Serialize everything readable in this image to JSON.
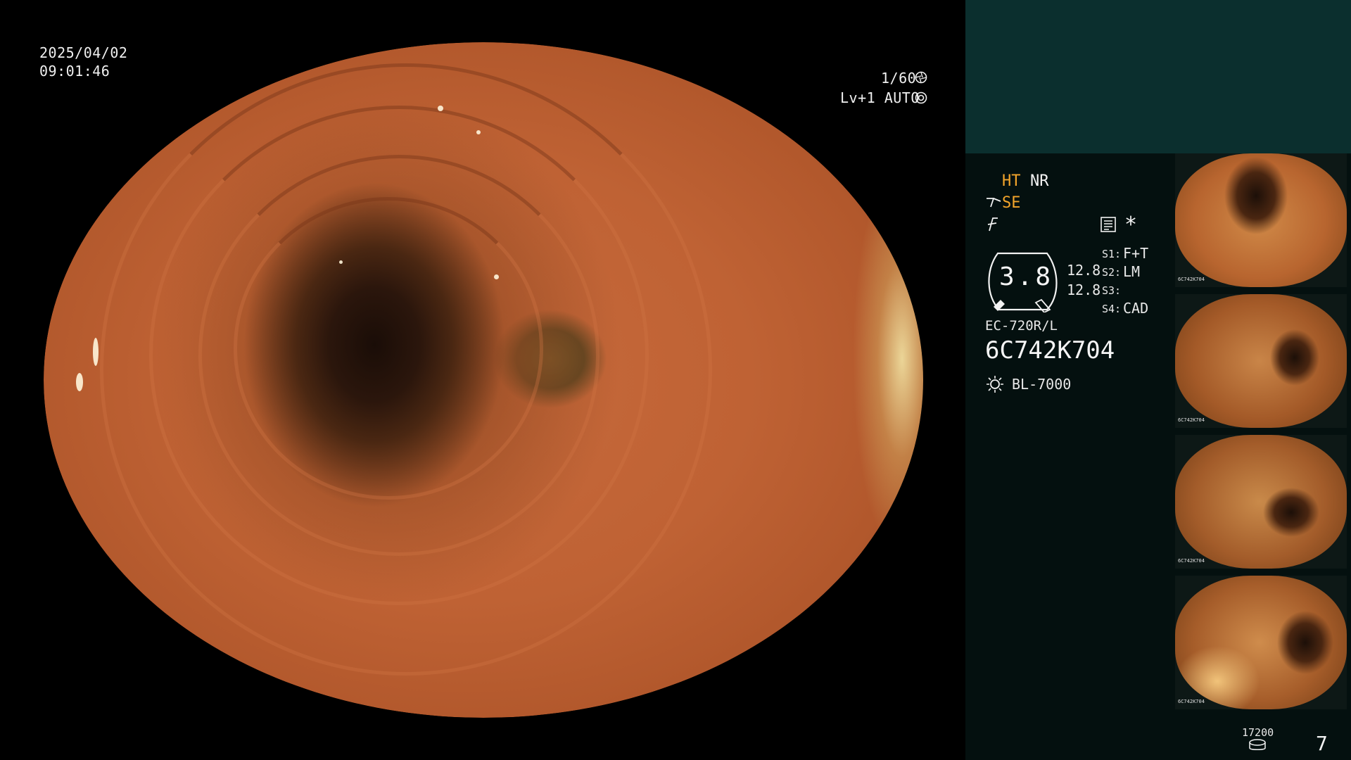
{
  "overlay": {
    "date": "2025/04/02",
    "time": "09:01:46",
    "shutter": "1/60",
    "level": "Lv+1 AUTO"
  },
  "panel": {
    "ht": "HT",
    "nr": "NR",
    "se": "SE",
    "dial_value": "3.8",
    "dial_right_top": "12.8",
    "dial_right_bottom": "12.8",
    "s1_label": "S1:",
    "s1_value": "F+T",
    "s2_label": "S2:",
    "s2_value": "LM",
    "s3_label": "S3:",
    "s3_value": "",
    "s4_label": "S4:",
    "s4_value": "CAD",
    "scope_model": "EC-720R/L",
    "serial": "6C742K704",
    "light_source": "BL-7000",
    "storage_count": "17200",
    "image_count": "7",
    "thumbnail_serial": "6C742K704"
  },
  "icons": {
    "shutter": "shutter-icon",
    "auto": "auto-iris-icon",
    "se": "scope-arm-icon",
    "f": "f-mode-icon",
    "keyboard": "keyboard-icon",
    "asterisk": "asterisk-icon",
    "light": "light-source-icon",
    "storage": "storage-disk-icon"
  },
  "colors": {
    "accent_yellow": "#f3a52b",
    "panel_top": "#0b2f2e",
    "panel_body": "#04100f"
  }
}
